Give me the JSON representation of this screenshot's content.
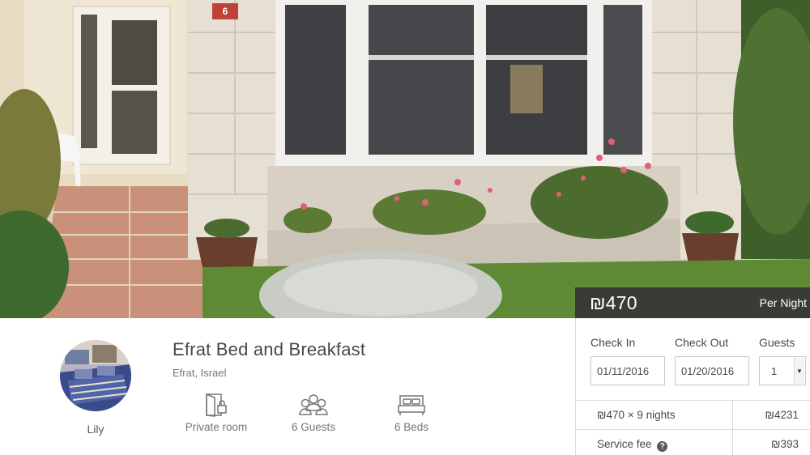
{
  "listing": {
    "title": "Efrat Bed and Breakfast",
    "location": "Efrat, Israel",
    "host": {
      "name": "Lily"
    },
    "house_number": "6",
    "amenities": [
      {
        "icon": "private-room-icon",
        "label": "Private room"
      },
      {
        "icon": "guests-icon",
        "label": "6 Guests"
      },
      {
        "icon": "bed-icon",
        "label": "6 Beds"
      }
    ]
  },
  "booking": {
    "price": "₪470",
    "per": "Per Night",
    "check_in_label": "Check In",
    "check_out_label": "Check Out",
    "guests_label": "Guests",
    "check_in_value": "01/11/2016",
    "check_out_value": "01/20/2016",
    "guests_value": "1",
    "nights_line": "₪470 × 9 nights",
    "nights_total": "₪4231",
    "service_fee_label": "Service fee",
    "service_fee_value": "₪393"
  },
  "colors": {
    "header_bg": "#363636",
    "border": "#dcdcdc",
    "text": "#484848",
    "muted": "#767676"
  }
}
